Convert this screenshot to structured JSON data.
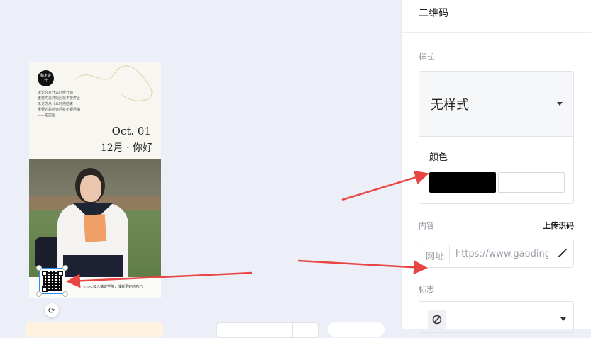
{
  "poster": {
    "logo_text": "稿定设计",
    "lines": [
      "无论你从什么时候开始",
      "重要的是开始后就不要停止",
      "无论你从什么时候结束",
      "重要的是结束后就不要后悔",
      "——柏拉图"
    ],
    "date": "Oct. 01",
    "greeting": "12月 · 你好",
    "caption": "<<< 加入稿定学院，成就更好的自己"
  },
  "panel": {
    "title": "二维码",
    "style_label": "样式",
    "style_value": "无样式",
    "color_label": "颜色",
    "colors": {
      "foreground": "#000000",
      "background": "#ffffff"
    },
    "content_label": "内容",
    "upload_label": "上传识码",
    "url_prefix": "网址",
    "url_value": "https://www.gaoding",
    "logo_label": "标志"
  },
  "icons": {
    "edit": "pencil-icon",
    "dropdown": "caret-down-icon",
    "rotate": "rotate-icon",
    "none": "ban-icon"
  },
  "annotation_color": "#e84545"
}
